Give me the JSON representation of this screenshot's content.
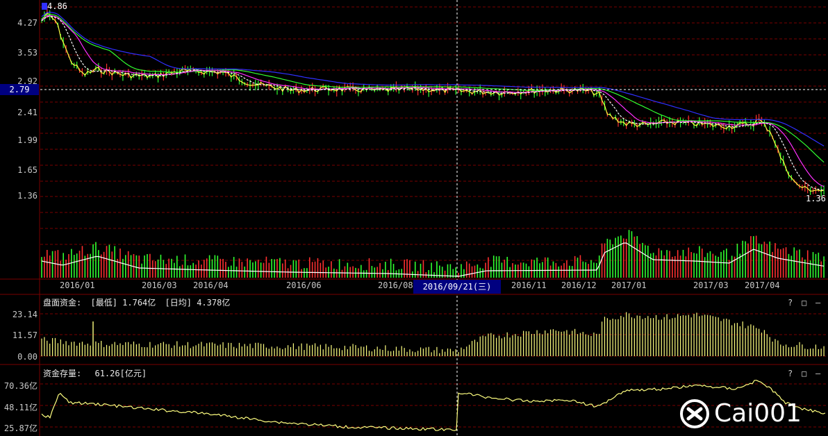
{
  "main_chart": {
    "y_ticks": [
      "4.27",
      "3.53",
      "2.92",
      "2.41",
      "1.99",
      "1.65",
      "1.36"
    ],
    "high_label": "4.86",
    "low_label": "1.36",
    "crosshair_price": "2.79",
    "x_ticks": [
      "2016/01",
      "2016/03",
      "2016/04",
      "2016/06",
      "2016/08",
      "2016/11",
      "2016/12",
      "2017/01",
      "2017/03",
      "2017/04"
    ],
    "crosshair_date": "2016/09/21(三)"
  },
  "fund_panel": {
    "title": "盘面资金:",
    "min_tag": "[最低] 1.764亿",
    "avg_tag": "[日均] 4.378亿",
    "y_ticks": [
      "23.14",
      "11.57",
      "0.00"
    ]
  },
  "stock_panel": {
    "title": "资金存量:",
    "value": "61.26[亿元]",
    "y_ticks": [
      "70.36亿",
      "48.11亿",
      "25.87亿"
    ]
  },
  "panel_controls": {
    "help": "?",
    "max": "□",
    "min": "—"
  },
  "watermark": {
    "text": "Cai001"
  },
  "colors": {
    "grid": "#7a0000",
    "price": "#ffff40",
    "ma_blue": "#3030ff",
    "ma_green": "#30ff30",
    "ma_magenta": "#ff30ff",
    "vol_up": "#ff3030",
    "vol_down": "#30ff30",
    "line_yellow": "#ffff80"
  }
}
